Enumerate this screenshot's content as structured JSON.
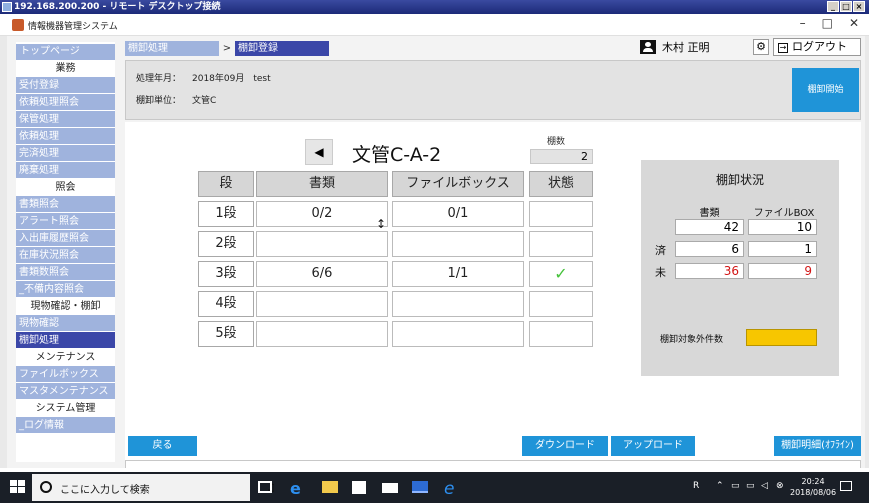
{
  "rdp": {
    "title": "192.168.200.200 - リモート デスクトップ接続"
  },
  "app": {
    "title": "情報機器管理システム"
  },
  "sidebar": {
    "top": "トップページ",
    "sections": [
      {
        "heading": "業務",
        "items": [
          "受付登録",
          "依頼処理照会",
          "保管処理",
          "依頼処理",
          "完済処理",
          "廃棄処理"
        ]
      },
      {
        "heading": "照会",
        "items": [
          "書類照会",
          "アラート照会",
          "入出庫履歴照会",
          "在庫状況照会",
          "書類数照会",
          "_不備内容照会"
        ]
      },
      {
        "heading": "現物確認・棚卸",
        "items": [
          "現物確認",
          "棚卸処理"
        ]
      },
      {
        "heading": "メンテナンス",
        "items": [
          "ファイルボックス",
          "マスタメンテナンス"
        ]
      },
      {
        "heading": "システム管理",
        "items": [
          "_ログ情報"
        ]
      }
    ],
    "active_item": "棚卸処理"
  },
  "breadcrumb": {
    "parent": "棚卸処理",
    "separator": ">",
    "current": "棚卸登録"
  },
  "user": {
    "name": "木村 正明",
    "logout_label": "ログアウト"
  },
  "info": {
    "period_label": "処理年月：",
    "period_value": "2018年09月　test",
    "unit_label": "棚卸単位：",
    "unit_value": "文管C",
    "start_button": "棚卸開始"
  },
  "shelf": {
    "name": "文管C-A-2",
    "count_label": "棚数",
    "count_value": "2",
    "columns": [
      "段",
      "書類",
      "ファイルボックス",
      "状態"
    ],
    "rows": [
      {
        "tier": "1段",
        "docs": "0/2",
        "boxes": "0/1",
        "status": ""
      },
      {
        "tier": "2段",
        "docs": "",
        "boxes": "",
        "status": ""
      },
      {
        "tier": "3段",
        "docs": "6/6",
        "boxes": "1/1",
        "status": "✓"
      },
      {
        "tier": "4段",
        "docs": "",
        "boxes": "",
        "status": ""
      },
      {
        "tier": "5段",
        "docs": "",
        "boxes": "",
        "status": ""
      }
    ]
  },
  "status": {
    "title": "棚卸状況",
    "col_docs": "書類",
    "col_boxes": "ファイルBOX",
    "total": {
      "label": "",
      "docs": "42",
      "boxes": "10"
    },
    "done": {
      "label": "済",
      "docs": "6",
      "boxes": "1"
    },
    "pending": {
      "label": "未",
      "docs": "36",
      "boxes": "9"
    },
    "excluded_label": "棚卸対象外件数",
    "excluded_value": "",
    "pending_color": "#d21414",
    "excluded_color": "#f7c600"
  },
  "buttons": {
    "back": "戻る",
    "download": "ダウンロード",
    "upload": "アップロード",
    "detail": "棚卸明細(ｵﾌﾗｲﾝ)"
  },
  "taskbar": {
    "search_placeholder": "ここに入力して検索",
    "time": "20:24",
    "date": "2018/08/06"
  },
  "colors": {
    "accent": "#1f94d8",
    "nav": "#9fb3dd",
    "nav_active": "#3b47a8"
  }
}
